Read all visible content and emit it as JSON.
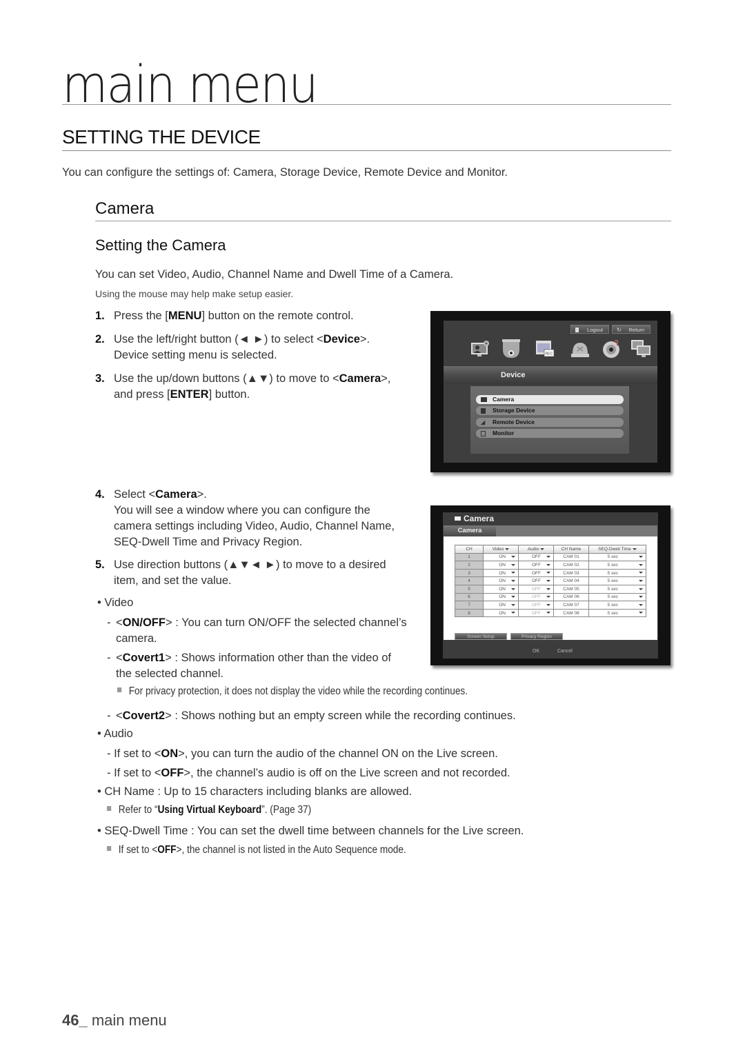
{
  "chapter_title": "main menu",
  "section_title": "SETTING THE DEVICE",
  "intro": "You can configure the settings of: Camera, Storage Device, Remote Device and Monitor.",
  "subsection": "Camera",
  "subsubsection": "Setting the Camera",
  "lead": "You can set Video, Audio, Channel Name and Dwell Time of a Camera.",
  "hint": "Using the mouse may help make setup easier.",
  "steps": [
    {
      "num": "1.",
      "pre": "Press the [",
      "bold": "MENU",
      "post": "] button on the remote control."
    },
    {
      "num": "2.",
      "pre": "Use the left/right button (◄ ►) to select <",
      "bold": "Device",
      "post": ">.",
      "line2": "Device setting menu is selected."
    },
    {
      "num": "3.",
      "pre": "Use the up/down buttons (▲▼) to move to <",
      "bold": "Camera",
      "post": ">,",
      "line2_pre": "and press [",
      "line2_bold": "ENTER",
      "line2_post": "] button."
    },
    {
      "num": "4.",
      "pre": "Select <",
      "bold": "Camera",
      "post": ">.",
      "line2": "You will see a window where you can configure the",
      "line3": "camera settings including Video, Audio, Channel Name,",
      "line4": "SEQ-Dwell Time and Privacy Region."
    },
    {
      "num": "5.",
      "pre": "Use direction buttons (▲▼◄ ►) to move to a desired",
      "line2": "item, and set the value."
    }
  ],
  "bullets": {
    "video": "• Video",
    "onoff_bold": "ON/OFF",
    "onoff_text": " : You can turn ON/OFF the selected channel’s",
    "onoff_line2": "camera.",
    "covert1_bold": "Covert1",
    "covert1_text": " : Shows information other than the video of",
    "covert1_line2": "the selected channel.",
    "covert1_note": "For privacy protection, it does not display the video while the recording continues.",
    "covert2_bold": "Covert2",
    "covert2_text": " : Shows nothing but an empty screen while the recording continues.",
    "audio": "• Audio",
    "audio_on_pre": "- If set to <",
    "audio_on_bold": "ON",
    "audio_on_post": ">, you can turn the audio of the channel ON on the Live screen.",
    "audio_off_pre": "- If set to <",
    "audio_off_bold": "OFF",
    "audio_off_post": ">, the channel’s audio is off on the Live screen and not recorded.",
    "chname": "• CH Name : Up to 15 characters including blanks are allowed.",
    "chname_note_pre": "Refer to “",
    "chname_note_bold": "Using Virtual Keyboard",
    "chname_note_post": "”. (Page 37)",
    "dwell": "• SEQ-Dwell Time : You can set the dwell time between channels for the Live screen.",
    "dwell_note_pre": "If set to <",
    "dwell_note_bold": "OFF",
    "dwell_note_post": ">, the channel is not listed in the Auto Sequence mode."
  },
  "device_menu": {
    "logout": "Logout",
    "return": "Return",
    "icons": [
      "system-setup-icon",
      "device-icon",
      "record-schedule-icon",
      "record-icon",
      "event-icon",
      "network-icon"
    ],
    "bar_label": "Device",
    "items": [
      {
        "label": "Camera",
        "selected": true,
        "icon": "camera-icon"
      },
      {
        "label": "Storage Device",
        "selected": false,
        "icon": "storage-icon"
      },
      {
        "label": "Remote Device",
        "selected": false,
        "icon": "remote-icon"
      },
      {
        "label": "Monitor",
        "selected": false,
        "icon": "monitor-icon"
      }
    ]
  },
  "camera_window": {
    "title": "Camera",
    "tab": "Camera",
    "headers": [
      "CH",
      "Video",
      "Audio",
      "CH Name",
      "SEQ-Dwell Time"
    ],
    "rows": [
      {
        "ch": "1",
        "video": "ON",
        "audio": "OFF",
        "name": "CAM 01",
        "dwell": "5 sec"
      },
      {
        "ch": "2",
        "video": "ON",
        "audio": "OFF",
        "name": "CAM 02",
        "dwell": "5 sec"
      },
      {
        "ch": "3",
        "video": "ON",
        "audio": "OFF",
        "name": "CAM 03",
        "dwell": "5 sec"
      },
      {
        "ch": "4",
        "video": "ON",
        "audio": "OFF",
        "name": "CAM 04",
        "dwell": "5 sec"
      },
      {
        "ch": "5",
        "video": "ON",
        "audio": "OFF",
        "name": "CAM 05",
        "dwell": "5 sec"
      },
      {
        "ch": "6",
        "video": "ON",
        "audio": "OFF",
        "name": "CAM 06",
        "dwell": "5 sec"
      },
      {
        "ch": "7",
        "video": "ON",
        "audio": "OFF",
        "name": "CAM 07",
        "dwell": "5 sec"
      },
      {
        "ch": "8",
        "video": "ON",
        "audio": "OFF",
        "name": "CAM 08",
        "dwell": "5 sec"
      }
    ],
    "screen_setup": "Screen Setup",
    "privacy_region": "Privacy Region",
    "ok": "OK",
    "cancel": "Cancel"
  },
  "footer": {
    "page": "46_",
    "label": " main menu"
  }
}
